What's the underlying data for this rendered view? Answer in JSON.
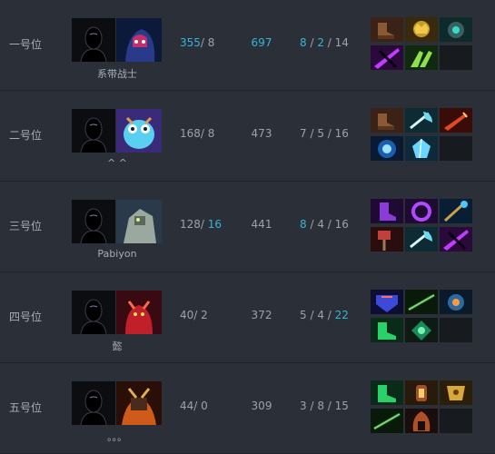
{
  "rows": [
    {
      "position": "一号位",
      "player": "系带战士",
      "hero": "dark-rider-hero",
      "last_hits": "355",
      "denies": "8",
      "lh_highlight": true,
      "denies_highlight": false,
      "net_worth": "697",
      "nw_highlight": true,
      "kills": "8",
      "deaths": "2",
      "assists": "14",
      "k_hl": true,
      "d_hl": true,
      "a_hl": false,
      "items": [
        "boots-icon",
        "crown-icon",
        "orb-helm-icon",
        "purple-blade-icon",
        "green-claw-icon",
        "empty-slot"
      ]
    },
    {
      "position": "二号位",
      "player": "^ ^",
      "hero": "puck-hero",
      "last_hits": "168",
      "denies": "8",
      "lh_highlight": false,
      "denies_highlight": false,
      "net_worth": "473",
      "nw_highlight": false,
      "kills": "7",
      "deaths": "5",
      "assists": "16",
      "k_hl": false,
      "d_hl": false,
      "a_hl": false,
      "items": [
        "boots-icon",
        "axe-icon",
        "dagger-icon",
        "blue-orb-icon",
        "crystal-icon",
        "empty-slot"
      ]
    },
    {
      "position": "三号位",
      "player": "Pabiyon",
      "hero": "tiny-hero",
      "last_hits": "128",
      "denies": "16",
      "lh_highlight": false,
      "denies_highlight": true,
      "net_worth": "441",
      "nw_highlight": false,
      "kills": "8",
      "deaths": "4",
      "assists": "16",
      "k_hl": true,
      "d_hl": false,
      "a_hl": false,
      "items": [
        "purple-boots-icon",
        "ring-icon",
        "staff-icon",
        "hammer-icon",
        "axe-icon",
        "purple-blade-icon"
      ]
    },
    {
      "position": "四号位",
      "player": "懿",
      "hero": "shadow-demon-hero",
      "last_hits": "40",
      "denies": "2",
      "lh_highlight": false,
      "denies_highlight": false,
      "net_worth": "372",
      "nw_highlight": false,
      "kills": "5",
      "deaths": "4",
      "assists": "22",
      "k_hl": false,
      "d_hl": false,
      "a_hl": true,
      "items": [
        "armor-icon",
        "green-blade-icon",
        "amulet-icon",
        "green-boots-icon",
        "green-gem-icon",
        "empty-slot"
      ]
    },
    {
      "position": "五号位",
      "player": "。。。",
      "hero": "warlord-hero",
      "last_hits": "44",
      "denies": "0",
      "lh_highlight": false,
      "denies_highlight": false,
      "net_worth": "309",
      "nw_highlight": false,
      "kills": "3",
      "deaths": "8",
      "assists": "15",
      "k_hl": false,
      "d_hl": false,
      "a_hl": false,
      "items": [
        "green-boots-icon",
        "lantern-icon",
        "gold-crest-icon",
        "green-blade-icon",
        "hood-icon",
        "empty-slot"
      ]
    }
  ],
  "colors": {
    "highlight": "#35b4d6",
    "text": "#9aa2ab",
    "background": "#2b3038"
  }
}
